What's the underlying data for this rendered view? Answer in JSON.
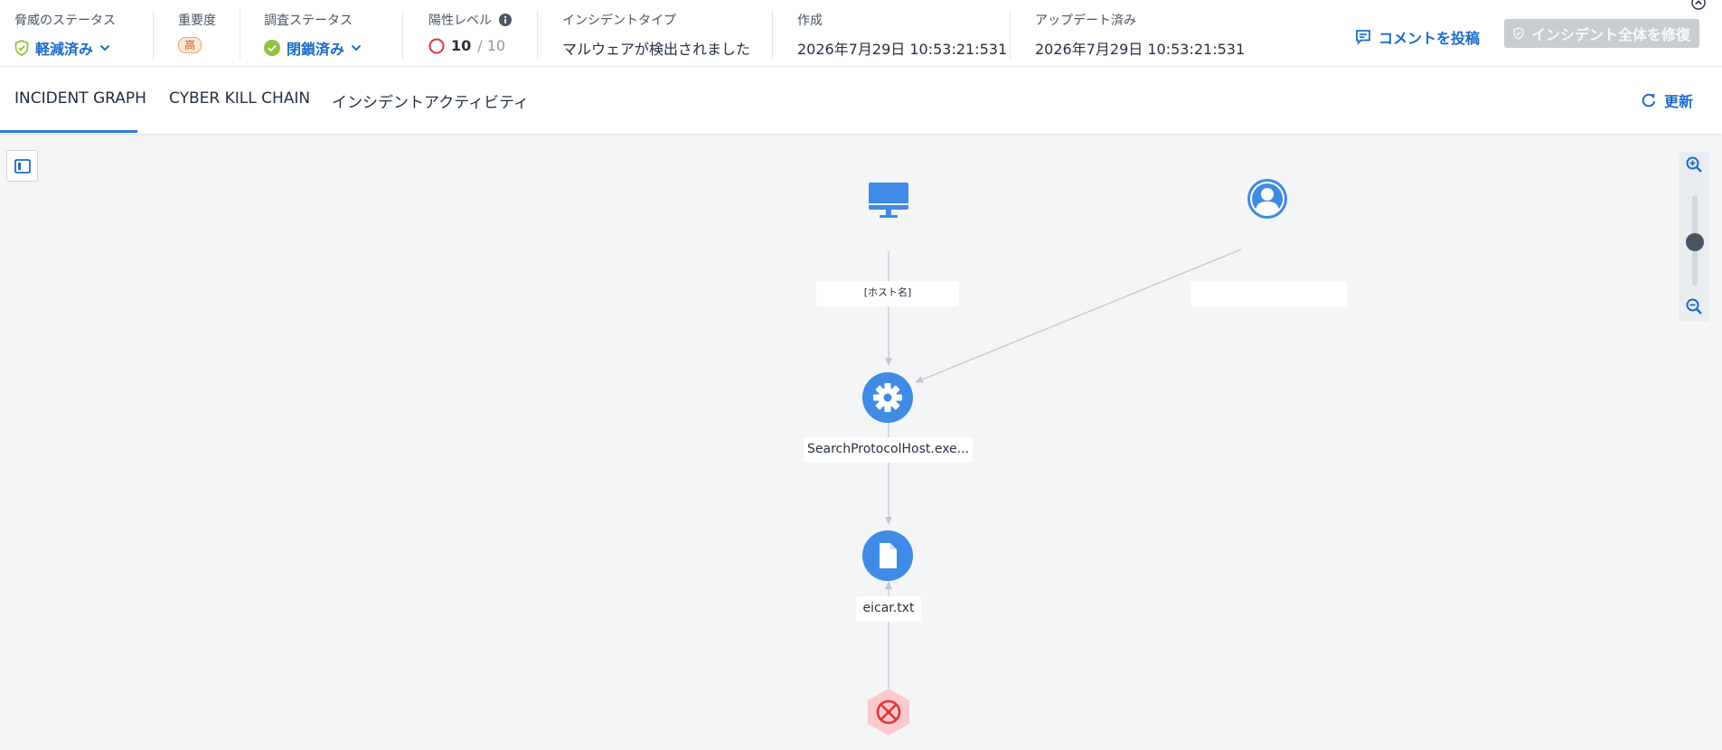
{
  "header": {
    "threat_status": {
      "label": "脅威のステータス",
      "value": "軽減済み"
    },
    "severity": {
      "label": "重要度",
      "value": "高"
    },
    "investigation": {
      "label": "調査ステータス",
      "value": "閉鎖済み"
    },
    "positivity": {
      "label": "陽性レベル",
      "value": "10",
      "max": "/ 10"
    },
    "incident_type": {
      "label": "インシデントタイプ",
      "value": "マルウェアが検出されました"
    },
    "created": {
      "label": "作成",
      "value": "2026年7月29日 10:53:21:531"
    },
    "updated": {
      "label": "アップデート済み",
      "value": "2026年7月29日 10:53:21:531"
    },
    "comment_button": "コメントを投稿",
    "remediate_button": "インシデント全体を修復"
  },
  "tabs": [
    {
      "label": "INCIDENT GRAPH",
      "active": true
    },
    {
      "label": "CYBER KILL CHAIN",
      "active": false
    },
    {
      "label": "インシデントアクティビティ",
      "active": false
    }
  ],
  "refresh_label": "更新",
  "graph": {
    "nodes": [
      {
        "type": "host",
        "icon": "monitor-icon",
        "label": "[ホスト名]"
      },
      {
        "type": "user",
        "icon": "user-icon",
        "label": ""
      },
      {
        "type": "process",
        "icon": "gear-icon",
        "label": "SearchProtocolHost.exe..."
      },
      {
        "type": "file",
        "icon": "file-icon",
        "label": "eicar.txt"
      },
      {
        "type": "detection",
        "icon": "threat-icon",
        "label": ""
      }
    ]
  },
  "colors": {
    "accent": "#1b6bc8",
    "node": "#3f8be6",
    "success": "#8cc63f",
    "danger": "#e2343c"
  }
}
